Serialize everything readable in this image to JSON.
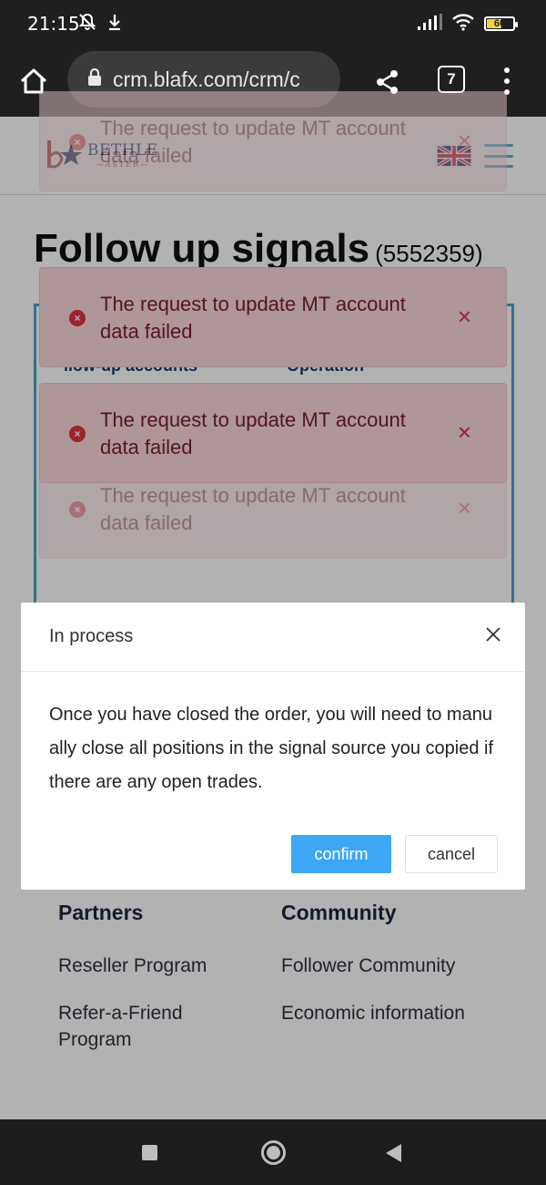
{
  "status_bar": {
    "time": "21:15",
    "battery_level": 60,
    "battery_label": "60",
    "icons": [
      "muted-notifications-icon",
      "download-icon",
      "signal-icon",
      "wifi-icon",
      "battery-icon"
    ]
  },
  "browser": {
    "url": "crm.blafx.com/crm/c",
    "tab_count": "7"
  },
  "site": {
    "brand_name": "BETHLE",
    "brand_sub": "—ASTER—",
    "language_flag": "uk-flag-icon"
  },
  "page": {
    "title": "Follow up signals",
    "account": "(5552359)",
    "table_headers": [
      "llow-up accounts",
      "Operation"
    ]
  },
  "toasts": [
    {
      "message": "The request to update MT account data failed",
      "close": "×",
      "faded": true
    },
    {
      "message": "The request to update MT account data failed",
      "close": "×",
      "faded": false
    },
    {
      "message": "The request to update MT account data failed",
      "close": "×",
      "faded": false
    },
    {
      "message": "The request to update MT account data failed",
      "close": "×",
      "faded": true
    }
  ],
  "dialog": {
    "title": "In process",
    "body": "Once you have closed the order, you will need to manually close all positions in the signal source you copied if there are any open trades.",
    "confirm_label": "confirm",
    "cancel_label": "cancel"
  },
  "footer": {
    "partners": {
      "heading": "Partners",
      "links": [
        "Reseller Program",
        "Refer-a-Friend Program"
      ]
    },
    "community": {
      "heading": "Community",
      "links": [
        "Follower Community",
        "Economic information"
      ]
    }
  },
  "colors": {
    "toast_bg": "#f9d7dc",
    "toast_text": "#7a1f2b",
    "error_red": "#e0313f",
    "confirm_blue": "#3da7f5",
    "table_border": "#4aa3c9"
  }
}
